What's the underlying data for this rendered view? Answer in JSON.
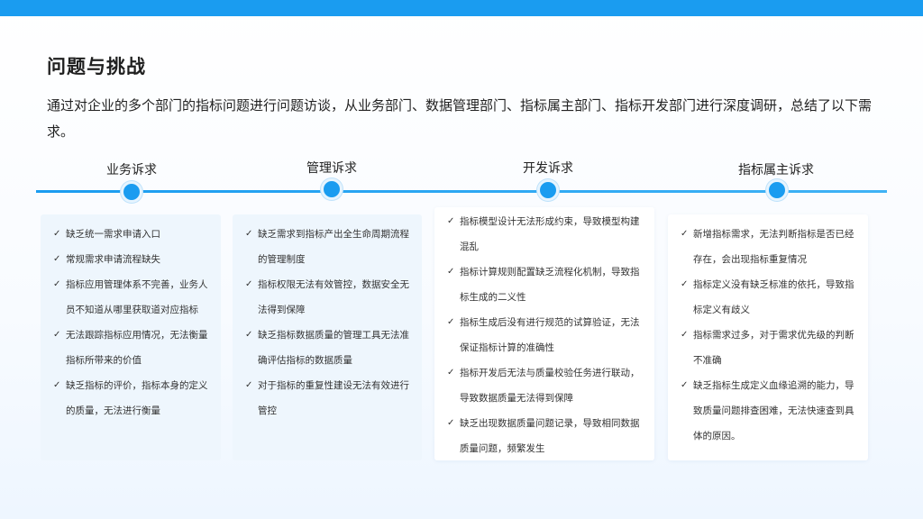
{
  "slide": {
    "title": "问题与挑战",
    "intro": "通过对企业的多个部门的指标问题进行问题访谈，从业务部门、数据管理部门、指标属主部门、指标开发部门进行深度调研，总结了以下需求。"
  },
  "colors": {
    "accent": "#1a9cf0",
    "card_light": "#eef6fd",
    "card_white": "#ffffff"
  },
  "stages": [
    {
      "label": "业务诉求",
      "items": [
        "缺乏统一需求申请入口",
        "常规需求申请流程缺失",
        "指标应用管理体系不完善，业务人员不知道从哪里获取道对应指标",
        "无法跟踪指标应用情况，无法衡量指标所带来的价值",
        "缺乏指标的评价，指标本身的定义的质量，无法进行衡量"
      ]
    },
    {
      "label": "管理诉求",
      "items": [
        "缺乏需求到指标产出全生命周期流程的管理制度",
        "指标权限无法有效管控，数据安全无法得到保障",
        "缺乏指标数据质量的管理工具无法准确评估指标的数据质量",
        "对于指标的重复性建设无法有效进行管控"
      ]
    },
    {
      "label": "开发诉求",
      "items": [
        "指标模型设计无法形成约束，导致模型构建混乱",
        "指标计算规则配置缺乏流程化机制，导致指标生成的二义性",
        "指标生成后没有进行规范的试算验证，无法保证指标计算的准确性",
        "指标开发后无法与质量校验任务进行联动，导致数据质量无法得到保障",
        "缺乏出现数据质量问题记录，导致相同数据质量问题，频繁发生"
      ]
    },
    {
      "label": "指标属主诉求",
      "items": [
        "新增指标需求，无法判断指标是否已经存在，会出现指标重复情况",
        "指标定义没有缺乏标准的依托，导致指标定义有歧义",
        "指标需求过多，对于需求优先级的判断不准确",
        "缺乏指标生成定义血缘追溯的能力，导致质量问题排查困难，无法快速查到具体的原因。"
      ]
    }
  ]
}
